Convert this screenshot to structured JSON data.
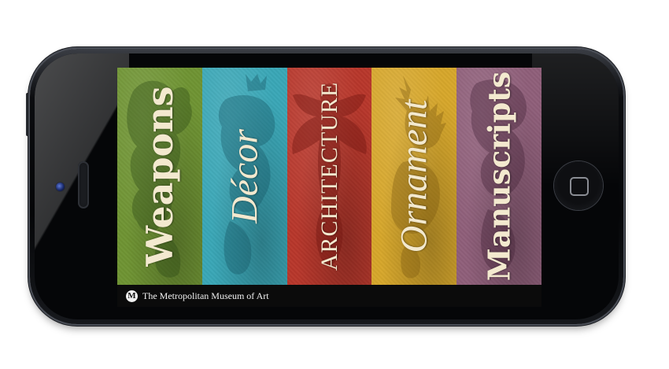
{
  "app": {
    "footer": {
      "logo_text": "M",
      "title": "The Metropolitan Museum of Art"
    },
    "categories": [
      {
        "label": "Weapons",
        "color": "#6f9433",
        "icon": "heraldic-lion-icon"
      },
      {
        "label": "Décor",
        "color": "#3aa7b7",
        "icon": "crowned-dragon-icon"
      },
      {
        "label": "ARCHITECTURE",
        "color": "#b8372b",
        "icon": "heraldic-eagle-icon"
      },
      {
        "label": "Ornament",
        "color": "#d7a72b",
        "icon": "stag-icon"
      },
      {
        "label": "Manuscripts",
        "color": "#8f5f7a",
        "icon": "heraldic-beast-icon"
      }
    ]
  },
  "device": {
    "home_button_icon": "home-square-icon"
  }
}
